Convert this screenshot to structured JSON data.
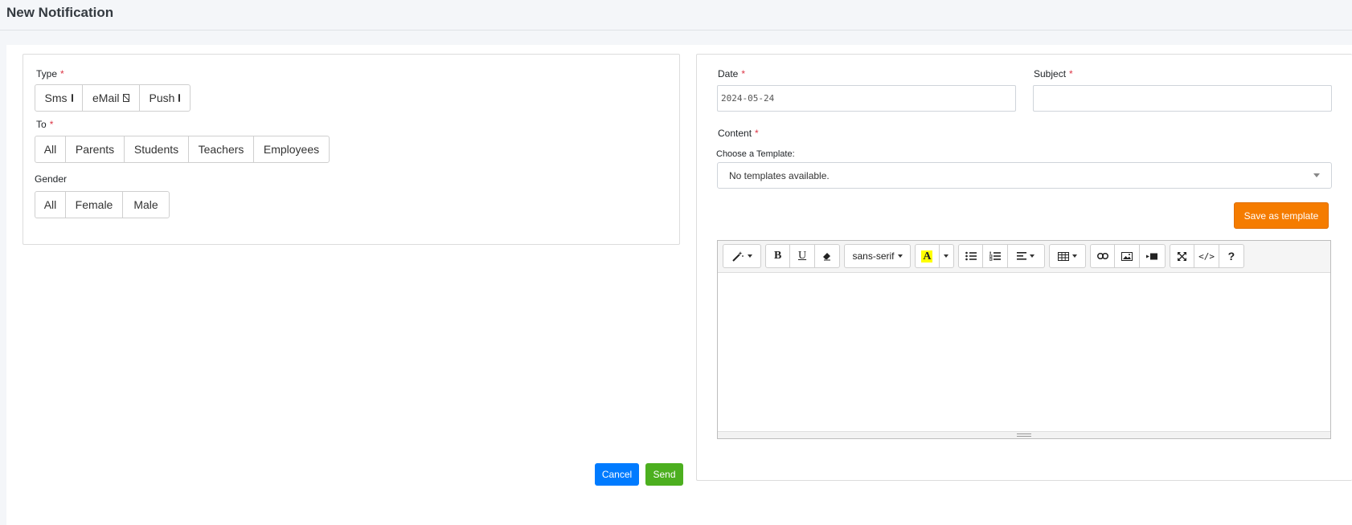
{
  "page": {
    "title": "New Notification"
  },
  "left": {
    "type": {
      "label": "Type",
      "required": "*",
      "options": [
        "Sms",
        "eMail",
        "Push"
      ]
    },
    "to": {
      "label": "To",
      "required": "*",
      "options": [
        "All",
        "Parents",
        "Students",
        "Teachers",
        "Employees"
      ]
    },
    "gender": {
      "label": "Gender",
      "options": [
        "All",
        "Female",
        "Male"
      ]
    }
  },
  "right": {
    "date": {
      "label": "Date",
      "required": "*",
      "value": "2024-05-24"
    },
    "subject": {
      "label": "Subject",
      "required": "*",
      "value": ""
    },
    "content": {
      "label": "Content",
      "required": "*"
    },
    "template": {
      "label": "Choose a Template:",
      "selected": "No templates available."
    },
    "save_template_label": "Save as template",
    "editor": {
      "font_name": "sans-serif",
      "bold": "B",
      "underline": "U",
      "code": "</>",
      "help": "?",
      "highlight_letter": "A",
      "highlight_color": "#ffff00"
    }
  },
  "footer": {
    "cancel_label": "Cancel",
    "send_label": "Send"
  }
}
